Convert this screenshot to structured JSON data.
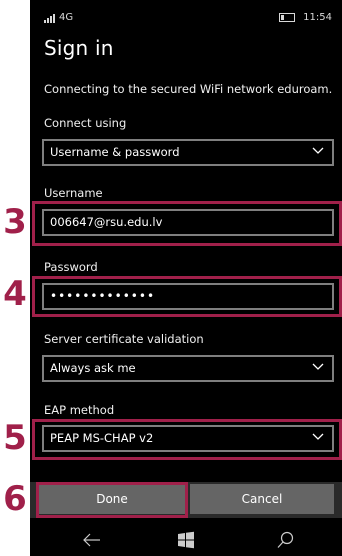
{
  "status_bar": {
    "network": "4G",
    "time": "11:54"
  },
  "page": {
    "title": "Sign in",
    "info": "Connecting to the secured WiFi network eduroam."
  },
  "form": {
    "connect_using": {
      "label": "Connect using",
      "value": "Username & password"
    },
    "username": {
      "label": "Username",
      "value": "006647@rsu.edu.lv"
    },
    "password": {
      "label": "Password",
      "value": "•••••••••••••"
    },
    "server_cert": {
      "label": "Server certificate validation",
      "value": "Always ask me"
    },
    "eap_method": {
      "label": "EAP method",
      "value": "PEAP MS-CHAP v2"
    }
  },
  "buttons": {
    "done": "Done",
    "cancel": "Cancel"
  },
  "annotations": {
    "n3": "3",
    "n4": "4",
    "n5": "5",
    "n6": "6"
  },
  "colors": {
    "highlight": "#a0204a",
    "background": "#000000",
    "button": "#656565"
  },
  "icons": [
    "back-arrow-icon",
    "windows-logo-icon",
    "search-icon",
    "chevron-down-icon",
    "signal-icon",
    "battery-icon"
  ]
}
